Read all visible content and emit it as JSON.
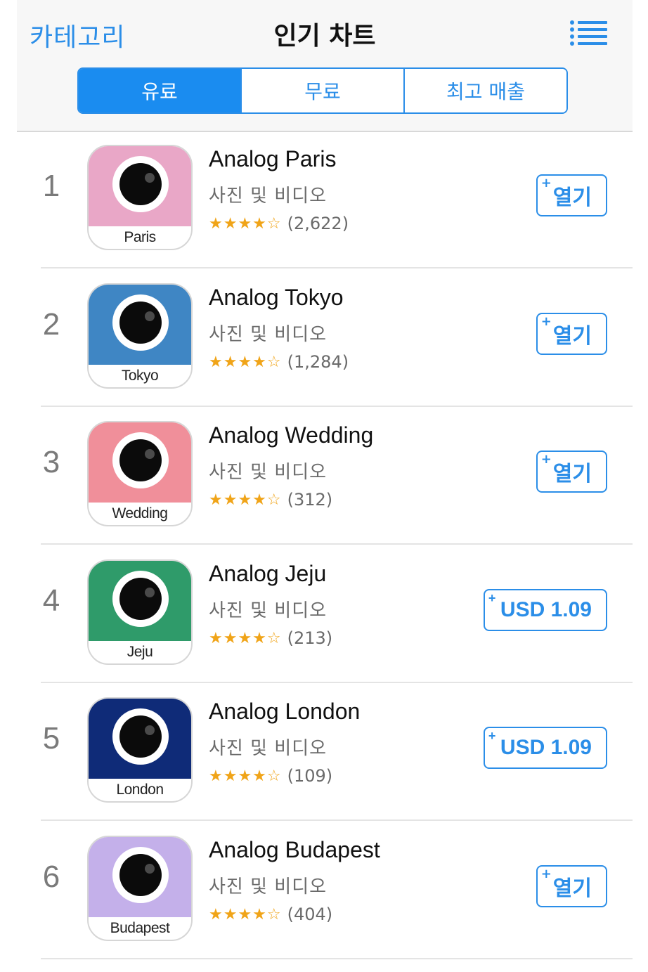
{
  "nav": {
    "back_label": "카테고리",
    "title": "인기 차트",
    "menu_icon": "list-icon"
  },
  "segments": [
    {
      "label": "유료",
      "active": true
    },
    {
      "label": "무료",
      "active": false
    },
    {
      "label": "최고 매출",
      "active": false
    }
  ],
  "apps": [
    {
      "rank": "1",
      "name": "Analog Paris",
      "category": "사진 및 비디오",
      "stars": "★★★★☆",
      "rating_count": "(2,622)",
      "icon_label": "Paris",
      "icon_color": "#e9a7c7",
      "button": "열기"
    },
    {
      "rank": "2",
      "name": "Analog Tokyo",
      "category": "사진 및 비디오",
      "stars": "★★★★☆",
      "rating_count": "(1,284)",
      "icon_label": "Tokyo",
      "icon_color": "#3f86c4",
      "button": "열기"
    },
    {
      "rank": "3",
      "name": "Analog Wedding",
      "category": "사진 및 비디오",
      "stars": "★★★★☆",
      "rating_count": "(312)",
      "icon_label": "Wedding",
      "icon_color": "#f08f9a",
      "button": "열기"
    },
    {
      "rank": "4",
      "name": "Analog Jeju",
      "category": "사진 및 비디오",
      "stars": "★★★★☆",
      "rating_count": "(213)",
      "icon_label": "Jeju",
      "icon_color": "#2f9b6a",
      "button": "USD 1.09"
    },
    {
      "rank": "5",
      "name": "Analog London",
      "category": "사진 및 비디오",
      "stars": "★★★★☆",
      "rating_count": "(109)",
      "icon_label": "London",
      "icon_color": "#0f2b78",
      "button": "USD 1.09"
    },
    {
      "rank": "6",
      "name": "Analog Budapest",
      "category": "사진 및 비디오",
      "stars": "★★★★☆",
      "rating_count": "(404)",
      "icon_label": "Budapest",
      "icon_color": "#c4b0ea",
      "button": "열기"
    }
  ],
  "plus_symbol": "+",
  "colors": {
    "accent": "#2b8ee8",
    "star": "#f0a418"
  }
}
